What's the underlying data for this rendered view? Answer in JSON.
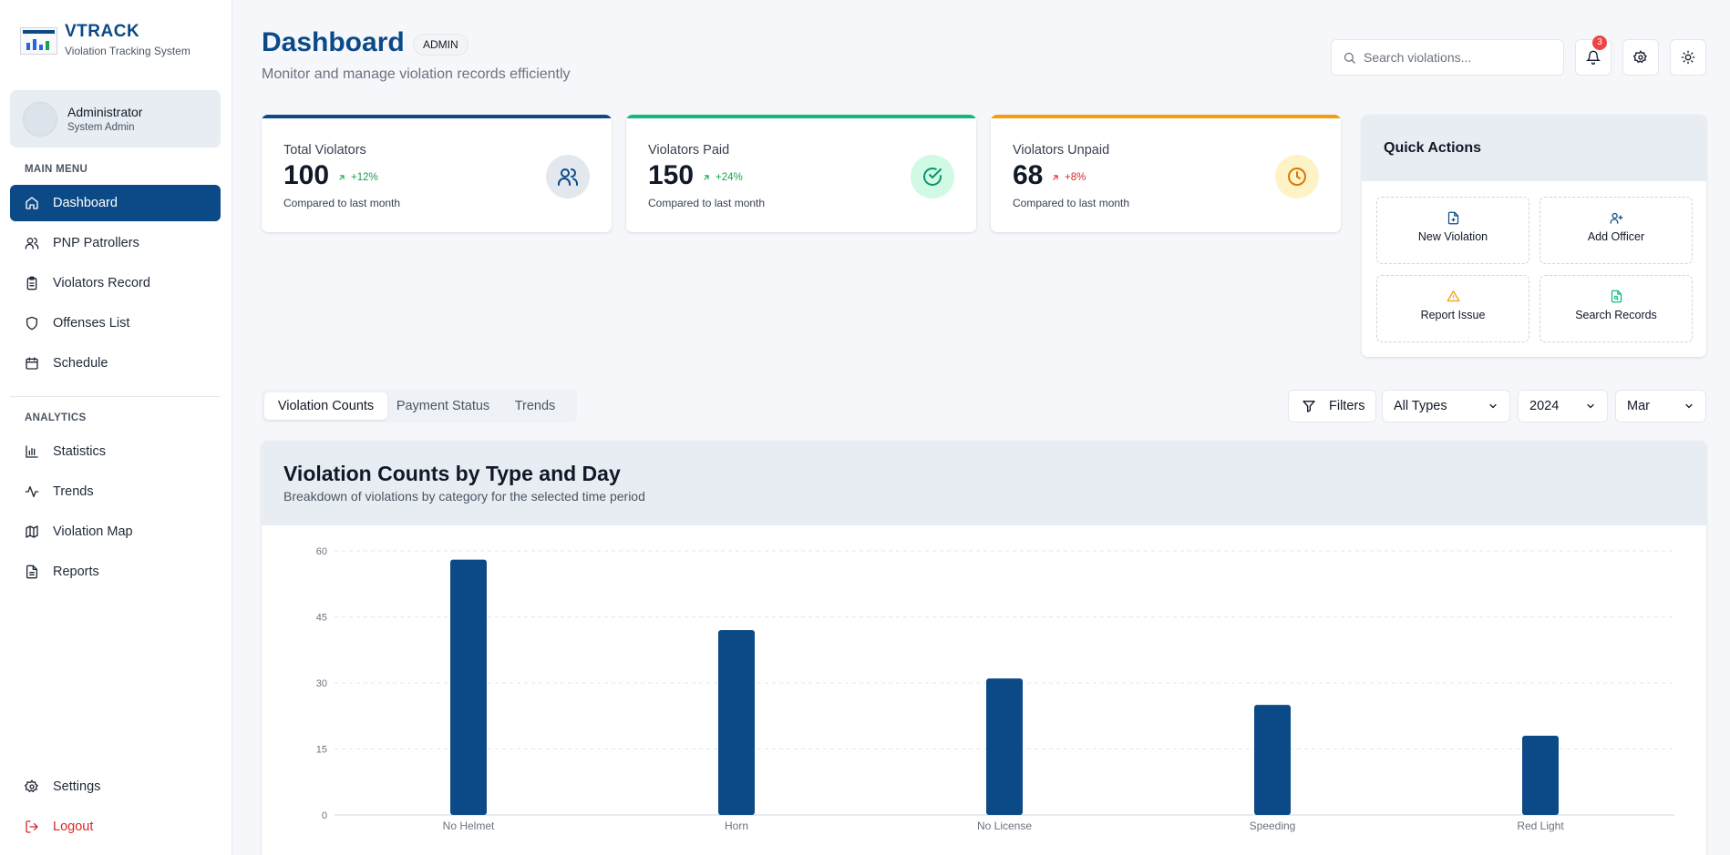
{
  "brand": {
    "title": "VTRACK",
    "subtitle": "Violation Tracking System"
  },
  "user": {
    "name": "Administrator",
    "role": "System Admin"
  },
  "sidebar": {
    "main_menu_label": "MAIN MENU",
    "analytics_label": "ANALYTICS",
    "main_items": [
      {
        "label": "Dashboard",
        "icon": "home-icon",
        "active": true
      },
      {
        "label": "PNP Patrollers",
        "icon": "users-icon"
      },
      {
        "label": "Violators Record",
        "icon": "clipboard-icon"
      },
      {
        "label": "Offenses List",
        "icon": "shield-icon"
      },
      {
        "label": "Schedule",
        "icon": "calendar-icon"
      }
    ],
    "analytics_items": [
      {
        "label": "Statistics",
        "icon": "bar-chart-icon"
      },
      {
        "label": "Trends",
        "icon": "activity-icon"
      },
      {
        "label": "Violation Map",
        "icon": "map-icon"
      },
      {
        "label": "Reports",
        "icon": "file-text-icon"
      }
    ],
    "settings_label": "Settings",
    "logout_label": "Logout"
  },
  "header": {
    "title": "Dashboard",
    "badge": "ADMIN",
    "subtitle": "Monitor and manage violation records efficiently",
    "search_placeholder": "Search violations...",
    "notification_count": "3"
  },
  "stats": [
    {
      "label": "Total Violators",
      "value": "100",
      "trend": "+12%",
      "compare": "Compared to last month",
      "accent": "#0b4a87",
      "trend_color": "#16a34a",
      "icon": "users-icon"
    },
    {
      "label": "Violators Paid",
      "value": "150",
      "trend": "+24%",
      "compare": "Compared to last month",
      "accent": "#10b981",
      "trend_color": "#16a34a",
      "icon": "check-circle-icon"
    },
    {
      "label": "Violators Unpaid",
      "value": "68",
      "trend": "+8%",
      "compare": "Compared to last month",
      "accent": "#f59e0b",
      "trend_color": "#dc2626",
      "icon": "clock-icon"
    }
  ],
  "quick_actions": {
    "title": "Quick Actions",
    "items": [
      {
        "label": "New Violation",
        "icon": "file-plus-icon",
        "color": "#0b4a87"
      },
      {
        "label": "Add Officer",
        "icon": "user-plus-icon",
        "color": "#0b4a87"
      },
      {
        "label": "Report Issue",
        "icon": "alert-triangle-icon",
        "color": "#f59e0b"
      },
      {
        "label": "Search Records",
        "icon": "file-search-icon",
        "color": "#10b981"
      }
    ]
  },
  "tabs": [
    "Violation Counts",
    "Payment Status",
    "Trends"
  ],
  "filters": {
    "label": "Filters",
    "type": "All Types",
    "year": "2024",
    "month": "Mar"
  },
  "chart": {
    "title": "Violation Counts by Type and Day",
    "subtitle": "Breakdown of violations by category for the selected time period"
  },
  "chart_data": {
    "type": "bar",
    "categories": [
      "No Helmet",
      "Horn",
      "No License",
      "Speeding",
      "Red Light"
    ],
    "values": [
      58,
      42,
      31,
      25,
      18
    ],
    "yticks": [
      0,
      15,
      30,
      45,
      60
    ],
    "ylim": [
      0,
      60
    ],
    "grid": true,
    "bar_color": "#0b4a87"
  }
}
